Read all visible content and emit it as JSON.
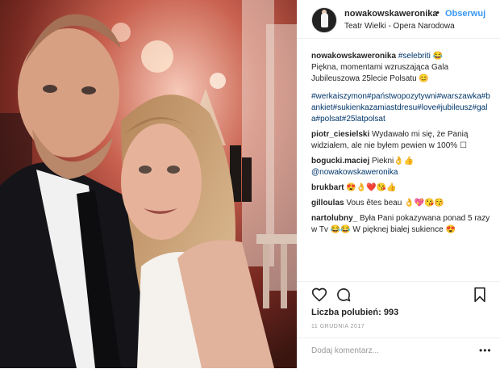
{
  "post": {
    "username": "nowakowskaweronika",
    "dot": "•",
    "follow_label": "Obserwuj",
    "location": "Teatr Wielki - Opera Narodowa"
  },
  "caption": {
    "author": "nowakowskaweronika",
    "tag": "#selebriti",
    "emoji": "😂",
    "text": "Piękna, momentami wzruszająca Gala Jubileuszowa 25lecie Polsatu 😊",
    "hashtags": "#werkaiszymon#państwopozytywni#warszawka#bankiet#sukienkazamiastdresu#love#jubileusz#gala#polsat#25latpolsat"
  },
  "comments": [
    {
      "author": "piotr_ciesielski",
      "text": "Wydawało mi się, że Panią widziałem, ale nie byłem pewien w 100% ☐"
    },
    {
      "author": "bogucki.maciej",
      "text": "Piekni👌👍",
      "mention": "@nowakowskaweronika"
    },
    {
      "author": "brukbart",
      "text": "😍👌❤️😘👍"
    },
    {
      "author": "gilloulas",
      "text": "Vous êtes beau 👌💖😘😚"
    },
    {
      "author": "nartolubny_",
      "text": "Była Pani pokazywana ponad 5 razy w Tv 😂😂 W pięknej białej sukience 😍"
    }
  ],
  "actions": {
    "like_icon": "heart-icon",
    "comment_icon": "comment-icon",
    "save_icon": "bookmark-icon",
    "likes_text": "Liczba polubień: 993",
    "date": "11 GRUDNIA 2017"
  },
  "add_comment": {
    "placeholder": "Dodaj komentarz...",
    "more_label": "•••"
  },
  "colors": {
    "link": "#3897f0",
    "hashtag": "#003569",
    "text": "#262626",
    "muted": "#999999"
  }
}
